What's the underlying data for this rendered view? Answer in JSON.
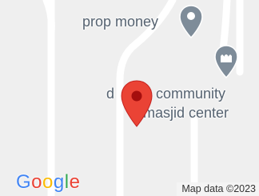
{
  "map": {
    "pois": [
      {
        "label": "prop money",
        "icon": "location-pin-icon"
      },
      {
        "label_line1": "d",
        "label_line1b": "n community",
        "label_line2": "masjid center",
        "icon": "mosque-pin-icon"
      }
    ],
    "selected_marker": {
      "icon": "red-location-pin-icon",
      "color": "#ea4335"
    },
    "logo": {
      "parts": [
        "G",
        "o",
        "o",
        "g",
        "l",
        "e"
      ],
      "colors": [
        "#4285f4",
        "#ea4335",
        "#fbbc05",
        "#4285f4",
        "#34a853",
        "#ea4335"
      ]
    },
    "attribution": "Map data ©2023",
    "colors": {
      "background": "#efefef",
      "road": "#ffffff",
      "poi_pin": "#7e8c99",
      "label": "#556270"
    }
  }
}
